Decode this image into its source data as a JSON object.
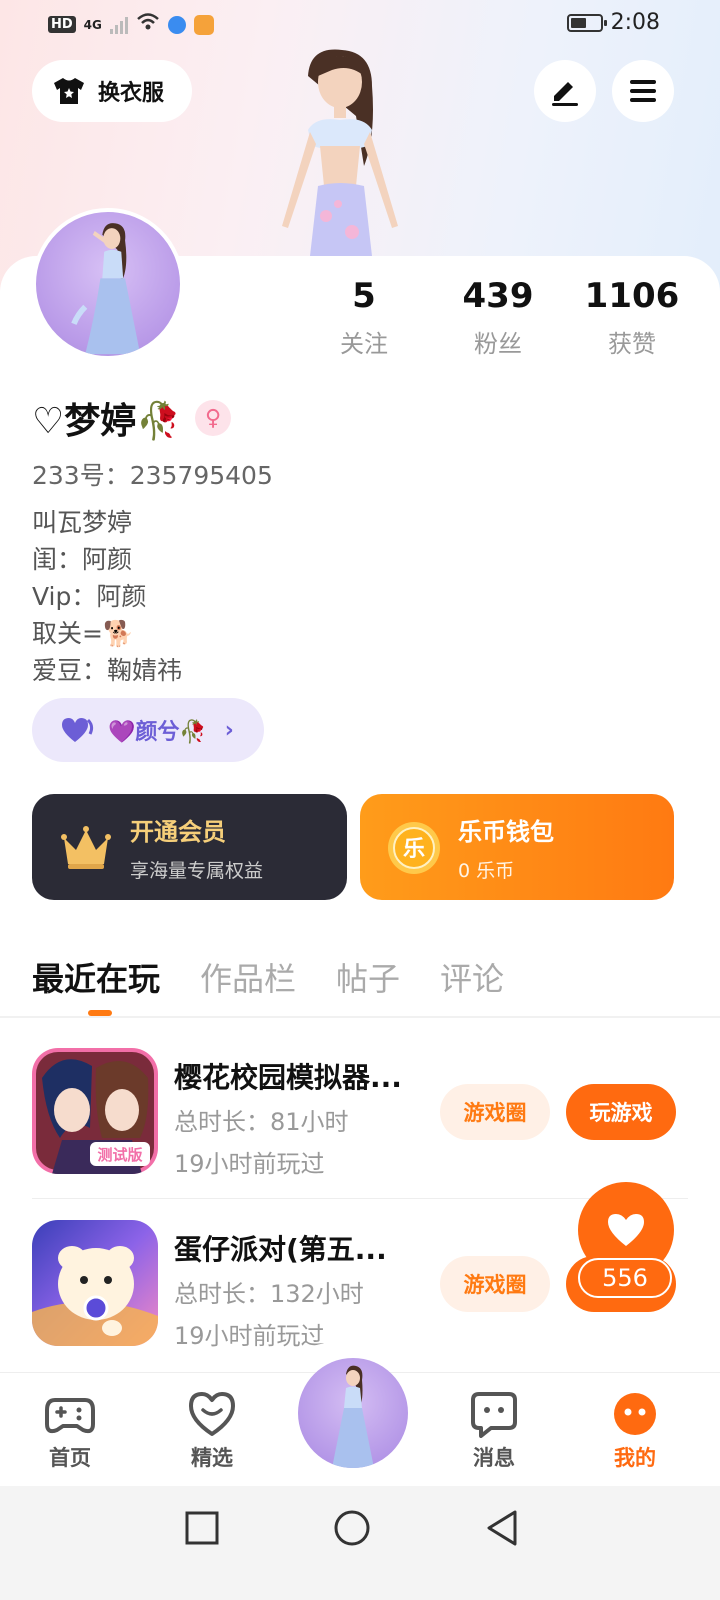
{
  "status_bar": {
    "hd_label": "HD",
    "network_label": "4G",
    "time": "2:08",
    "battery_level": 0.55
  },
  "header": {
    "outfit_button_label": "换衣服",
    "icons": [
      "shirt-icon",
      "edit-icon",
      "menu-icon"
    ]
  },
  "profile": {
    "stats": [
      {
        "value": "5",
        "label": "关注"
      },
      {
        "value": "439",
        "label": "粉丝"
      },
      {
        "value": "1106",
        "label": "获赞"
      }
    ],
    "username": "♡梦婷🥀",
    "gender_symbol": "♀",
    "id_line": "233号：235795405",
    "bio_lines": [
      "叫瓦梦婷",
      "闺：阿颜",
      "Vip：阿颜",
      "取关=🐕",
      "爱豆：鞠婧祎"
    ],
    "relation_pill_label": "💜颜兮🥀"
  },
  "promo_cards": {
    "vip": {
      "title": "开通会员",
      "subtitle": "享海量专属权益"
    },
    "wallet": {
      "title": "乐币钱包",
      "subtitle": "0 乐币",
      "coin_char": "乐"
    }
  },
  "tabs": [
    {
      "label": "最近在玩",
      "active": true
    },
    {
      "label": "作品栏",
      "active": false
    },
    {
      "label": "帖子",
      "active": false
    },
    {
      "label": "评论",
      "active": false
    }
  ],
  "games": [
    {
      "name": "樱花校园模拟器...",
      "duration": "总时长：81小时",
      "last_played": "19小时前玩过",
      "circle_label": "游戏圈",
      "play_label": "玩游戏",
      "icon_badge": "测试版"
    },
    {
      "name": "蛋仔派对(第五...",
      "duration": "总时长：132小时",
      "last_played": "19小时前玩过",
      "circle_label": "游戏圈",
      "play_label": "玩游戏"
    }
  ],
  "like_widget": {
    "count": "556"
  },
  "bottom_nav": [
    {
      "label": "首页",
      "icon": "gamepad-icon"
    },
    {
      "label": "精选",
      "icon": "heart-chat-icon"
    },
    {
      "label": "",
      "icon": "avatar"
    },
    {
      "label": "消息",
      "icon": "message-icon"
    },
    {
      "label": "我的",
      "icon": "profile-face-icon"
    }
  ],
  "colors": {
    "accent": "#ff6a10",
    "vip_card": "#2b2b36",
    "vip_title": "#f6cf7a",
    "pill_bg": "#ece8fb",
    "pill_text": "#6c5ed6"
  }
}
